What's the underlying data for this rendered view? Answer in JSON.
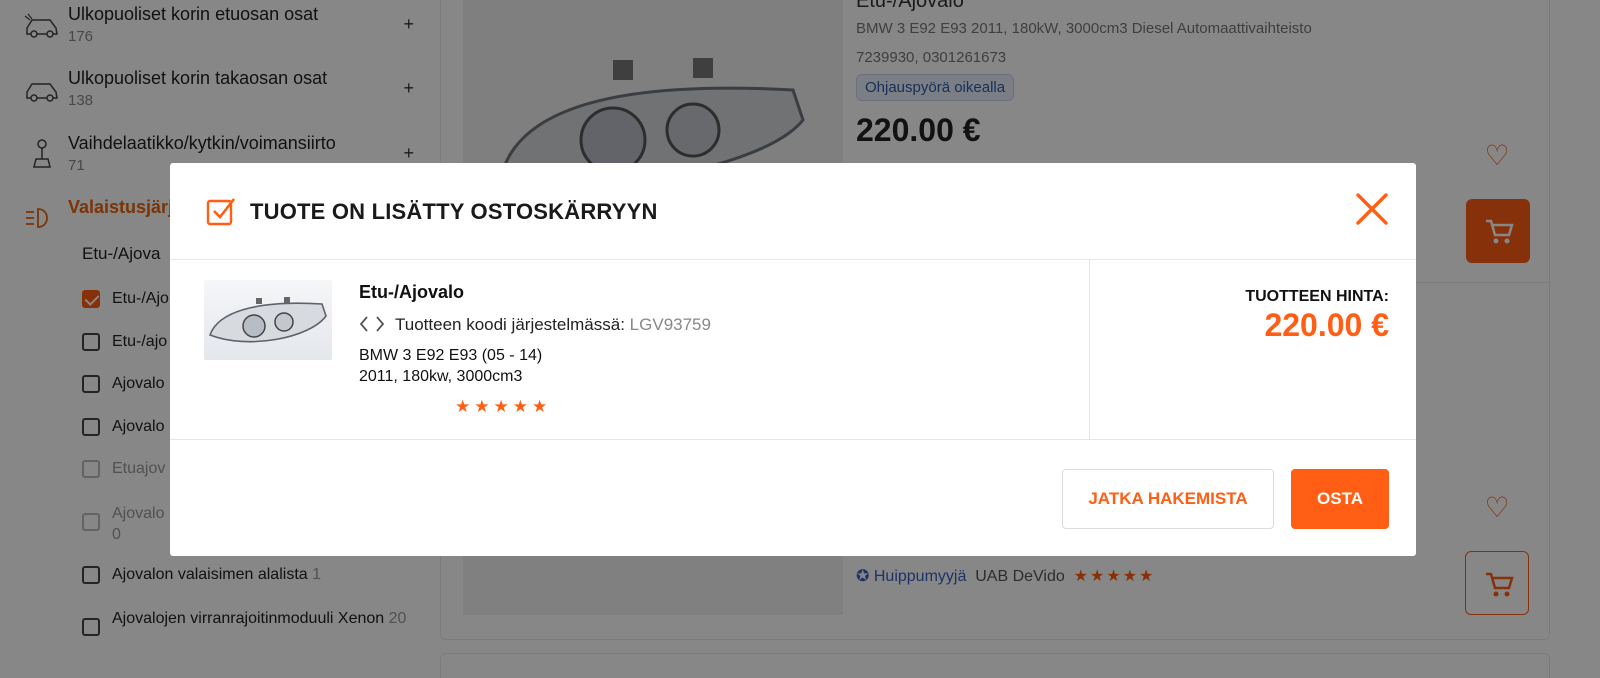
{
  "sidebar": {
    "categories": [
      {
        "title": "Ulkopuoliset korin etuosan osat",
        "count": "176",
        "plus": "+"
      },
      {
        "title": "Ulkopuoliset korin takaosan osat",
        "count": "138",
        "plus": "+"
      },
      {
        "title": "Vaihdelaatikko/kytkin/voimansiirto",
        "count": "71",
        "plus": "+"
      },
      {
        "title": "Valaistusjärj",
        "count": "",
        "plus": ""
      }
    ],
    "subheading": "Etu-/Ajova",
    "filters": [
      {
        "label": "Etu-/Ajo",
        "count": ""
      },
      {
        "label": "Etu-/ajo",
        "count": ""
      },
      {
        "label": "Ajovalo",
        "count": ""
      },
      {
        "label": "Ajovalo",
        "count": ""
      },
      {
        "label": "Etuajov",
        "count": ""
      },
      {
        "label": "Ajovalo",
        "count": "0"
      },
      {
        "label": "Ajovalon valaisimen alalista",
        "count": "1"
      },
      {
        "label": "Ajovalojen virranrajoitinmoduuli Xenon",
        "count": "20"
      }
    ]
  },
  "background_listing": {
    "title": "Etu-/Ajovalo",
    "specs": "BMW 3 E92 E93 2011, 180kW, 3000cm3 Diesel Automaattivaihteisto",
    "codes": "7239930, 0301261673",
    "badge": "Ohjauspyörä oikealla",
    "price": "220.00 €",
    "seller_label": "Huippumyyjä",
    "seller_name": "UAB DeVido",
    "seller_stars": "★★★★★"
  },
  "modal": {
    "title": "TUOTE ON LISÄTTY OSTOSKÄRRYYN",
    "product": {
      "name": "Etu-/Ajovalo",
      "code_label": "Tuotteen koodi järjestelmässä:",
      "code_value": "LGV93759",
      "compat_line1": "BMW 3 E92 E93 (05 - 14)",
      "compat_line2": "2011, 180kw, 3000cm3",
      "stars": "★★★★★"
    },
    "price_label": "TUOTTEEN HINTA:",
    "price_value": "220.00 €",
    "continue_label": "JATKA HAKEMISTA",
    "buy_label": "OSTA"
  },
  "colors": {
    "accent": "#ff5e14",
    "overlay": "rgba(0,0,0,0.47)"
  },
  "icons": [
    "car-front-icon",
    "car-rear-icon",
    "gear-shift-icon",
    "headlight-icon",
    "check-square-icon",
    "close-icon",
    "code-icon",
    "heart-icon",
    "cart-icon",
    "verified-icon"
  ]
}
